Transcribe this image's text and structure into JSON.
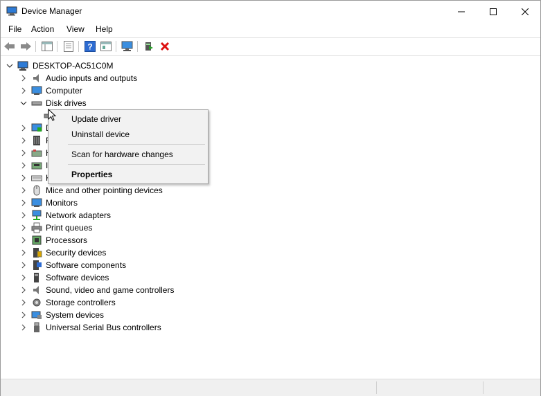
{
  "window": {
    "title": "Device Manager"
  },
  "menu": [
    "File",
    "Action",
    "View",
    "Help"
  ],
  "toolbar": {
    "buttons": [
      "back-icon",
      "forward-icon",
      "show-hide-tree-icon",
      "properties-icon",
      "help-icon",
      "view-icon",
      "scan-hardware-icon",
      "update-driver-icon",
      "uninstall-icon"
    ]
  },
  "tree": {
    "root": "DESKTOP-AC51C0M",
    "categories": [
      {
        "label": "Audio inputs and outputs",
        "icon": "speaker-icon",
        "expanded": false
      },
      {
        "label": "Computer",
        "icon": "monitor-icon",
        "expanded": false
      },
      {
        "label": "Disk drives",
        "icon": "disk-drive-icon",
        "expanded": true
      },
      {
        "label": "",
        "icon": "disk-icon",
        "child": true
      },
      {
        "label": "D",
        "icon": "display-adapter-icon",
        "expanded": false
      },
      {
        "label": "F",
        "icon": "firmware-icon",
        "expanded": false
      },
      {
        "label": "H",
        "icon": "hid-icon",
        "expanded": false
      },
      {
        "label": "I",
        "icon": "ide-icon",
        "expanded": false
      },
      {
        "label": "K",
        "icon": "keyboard-icon",
        "expanded": false
      },
      {
        "label": "Mice and other pointing devices",
        "icon": "mouse-icon",
        "expanded": false
      },
      {
        "label": "Monitors",
        "icon": "monitor-icon",
        "expanded": false
      },
      {
        "label": "Network adapters",
        "icon": "network-icon",
        "expanded": false
      },
      {
        "label": "Print queues",
        "icon": "printer-icon",
        "expanded": false
      },
      {
        "label": "Processors",
        "icon": "processor-icon",
        "expanded": false
      },
      {
        "label": "Security devices",
        "icon": "security-icon",
        "expanded": false
      },
      {
        "label": "Software components",
        "icon": "software-component-icon",
        "expanded": false
      },
      {
        "label": "Software devices",
        "icon": "software-device-icon",
        "expanded": false
      },
      {
        "label": "Sound, video and game controllers",
        "icon": "sound-icon",
        "expanded": false
      },
      {
        "label": "Storage controllers",
        "icon": "storage-icon",
        "expanded": false
      },
      {
        "label": "System devices",
        "icon": "system-icon",
        "expanded": false
      },
      {
        "label": "Universal Serial Bus controllers",
        "icon": "usb-icon",
        "expanded": false
      }
    ]
  },
  "context_menu": {
    "items": [
      "Update driver",
      "Uninstall device",
      "Scan for hardware changes",
      "Properties"
    ]
  }
}
